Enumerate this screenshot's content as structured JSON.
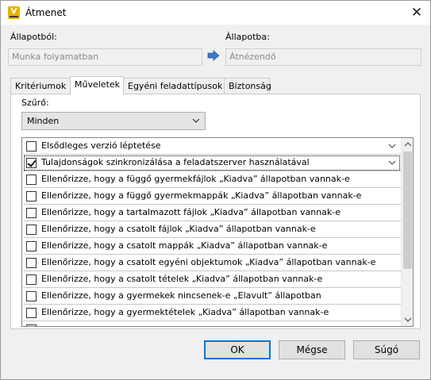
{
  "window": {
    "title": "Átmenet",
    "close_symbol": "✕"
  },
  "icons": {
    "app": "app-v-icon",
    "arrow": "arrow-right-icon",
    "close": "close-icon"
  },
  "from_state": {
    "label": "Állapotból:",
    "value": "Munka folyamatban"
  },
  "to_state": {
    "label": "Állapotba:",
    "value": "Átnézendő"
  },
  "tabs": [
    {
      "label": "Kritériumok",
      "active": false
    },
    {
      "label": "Műveletek",
      "active": true
    },
    {
      "label": "Egyéni feladattípusok",
      "active": false
    },
    {
      "label": "Biztonság",
      "active": false
    }
  ],
  "filter": {
    "label": "Szűrő:",
    "selected": "Minden"
  },
  "actions": [
    {
      "label": "Elsődleges verzió léptetése",
      "checked": false,
      "expandable": true
    },
    {
      "label": "Tulajdonságok szinkronizálása a feladatszerver használatával",
      "checked": true,
      "expandable": true
    },
    {
      "label": "Ellenőrizze, hogy a függő gyermekfájlok „Kiadva” állapotban vannak-e",
      "checked": false,
      "expandable": false
    },
    {
      "label": "Ellenőrizze, hogy a függő gyermekmappák „Kiadva” állapotban vannak-e",
      "checked": false,
      "expandable": false
    },
    {
      "label": "Ellenőrizze, hogy a tartalmazott fájlok „Kiadva” állapotban vannak-e",
      "checked": false,
      "expandable": false
    },
    {
      "label": "Ellenőrizze, hogy a csatolt fájlok „Kiadva” állapotban vannak-e",
      "checked": false,
      "expandable": false
    },
    {
      "label": "Ellenőrizze, hogy a csatolt mappák „Kiadva” állapotban vannak-e",
      "checked": false,
      "expandable": false
    },
    {
      "label": "Ellenőrizze, hogy a csatolt egyéni objektumok „Kiadva” állapotban vannak-e",
      "checked": false,
      "expandable": false
    },
    {
      "label": "Ellenőrizze, hogy a csatolt tételek „Kiadva” állapotban vannak-e",
      "checked": false,
      "expandable": false
    },
    {
      "label": "Ellenőrizze, hogy a gyermekek nincsenek-e „Elavult” állapotban",
      "checked": false,
      "expandable": false
    },
    {
      "label": "Ellenőrizze, hogy a gyermektételek „Kiadva” állapotban vannak-e",
      "checked": false,
      "expandable": false
    },
    {
      "label": "",
      "checked": false,
      "expandable": false
    }
  ],
  "buttons": {
    "ok": "OK",
    "cancel": "Mégse",
    "help": "Súgó"
  }
}
